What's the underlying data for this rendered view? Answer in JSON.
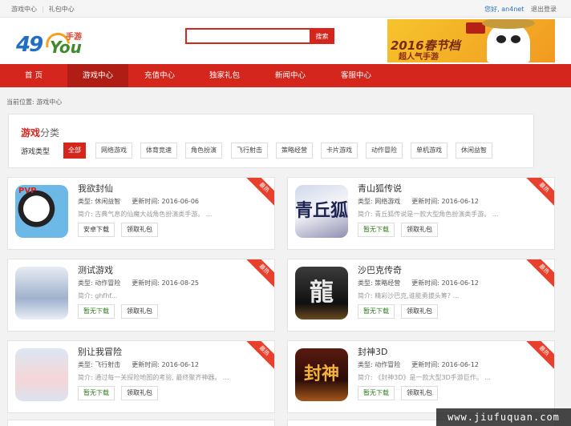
{
  "topbar": {
    "links": [
      "游戏中心",
      "礼包中心"
    ],
    "greeting": "您好,",
    "username": "an4net",
    "logout": "退出登录"
  },
  "logo": {
    "number": "49",
    "word": "You",
    "suffix": "手游"
  },
  "search": {
    "placeholder": "",
    "button_label": "搜索"
  },
  "banner": {
    "line1": "2016春节档",
    "line2": "超人气手游"
  },
  "nav": {
    "items": [
      "首 页",
      "游戏中心",
      "充值中心",
      "独家礼包",
      "新闻中心",
      "客服中心"
    ],
    "active_index": 1
  },
  "breadcrumb": "当前位置: 游戏中心",
  "category": {
    "title_red": "游戏",
    "title_gray": "分类",
    "type_label": "游戏类型",
    "chips": [
      "全部",
      "网络游戏",
      "体育竞速",
      "角色扮演",
      "飞行射击",
      "策略经营",
      "卡片游戏",
      "动作冒险",
      "单机游戏",
      "休闲益智"
    ],
    "active_index": 0
  },
  "games": [
    {
      "name": "我欲封仙",
      "type_label": "类型:",
      "type": "休闲益智",
      "update_label": "更新时间:",
      "update": "2016-06-06",
      "intro": "简介: 古典气息的仙魔大战角色扮演类手游。 ...",
      "download": "安卓下载",
      "gift": "领取礼包",
      "ribbon": "最热",
      "icon_text": "PVP"
    },
    {
      "name": "青山狐传说",
      "type_label": "类型:",
      "type": "网络游戏",
      "update_label": "更新时间:",
      "update": "2016-06-12",
      "intro": "简介: 青丘狐传说是一款大型角色扮演类手游。 ...",
      "download": "暂无下载",
      "gift": "领取礼包",
      "ribbon": "最热",
      "icon_text": "青丘狐"
    },
    {
      "name": "测试游戏",
      "type_label": "类型:",
      "type": "动作冒险",
      "update_label": "更新时间:",
      "update": "2016-08-25",
      "intro": "简介: ghfhf...",
      "download": "暂无下载",
      "gift": "领取礼包",
      "ribbon": "最热",
      "icon_text": ""
    },
    {
      "name": "沙巴克传奇",
      "type_label": "类型:",
      "type": "策略经营",
      "update_label": "更新时间:",
      "update": "2016-06-12",
      "intro": "简介: 精彩沙巴克,谁能勇拔头筹? ...",
      "download": "暂无下载",
      "gift": "领取礼包",
      "ribbon": "最热",
      "icon_text": "龍"
    },
    {
      "name": "别让我冒险",
      "type_label": "类型:",
      "type": "飞行射击",
      "update_label": "更新时间:",
      "update": "2016-06-12",
      "intro": "简介: 通过每一关探险地图的考验, 最终聚齐神器。 ...",
      "download": "暂无下载",
      "gift": "领取礼包",
      "ribbon": "最热",
      "icon_text": ""
    },
    {
      "name": "封神3D",
      "type_label": "类型:",
      "type": "动作冒险",
      "update_label": "更新时间:",
      "update": "2016-06-12",
      "intro": "简介: 《封神3D》是一款大型3D手游巨作。 ...",
      "download": "暂无下载",
      "gift": "领取礼包",
      "ribbon": "最热",
      "icon_text": "封神"
    }
  ],
  "watermark": "www.jiufuquan.com",
  "colors": {
    "brand_red": "#d4261c",
    "nav_active": "#b01d14",
    "download_green": "#2e7d1e",
    "link_blue": "#2a6fbf"
  }
}
